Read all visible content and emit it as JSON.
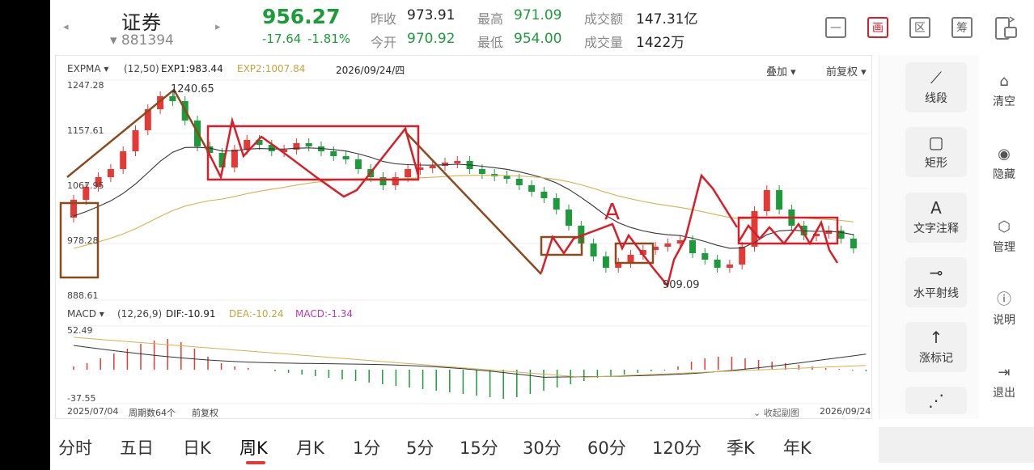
{
  "header": {
    "prev_arrow": "◂",
    "next_arrow": "▸",
    "title": "证券",
    "code": "▾ 881394",
    "price": "956.27",
    "change": "-17.64",
    "change_pct": "-1.81%",
    "stats": {
      "prev_close_label": "昨收",
      "prev_close": "973.91",
      "open_label": "今开",
      "open": "970.92",
      "high_label": "最高",
      "high": "971.09",
      "low_label": "最低",
      "low": "954.00",
      "turnover_label": "成交额",
      "turnover": "147.31亿",
      "volume_label": "成交量",
      "volume": "1422万"
    },
    "top_buttons": [
      "—",
      "画",
      "区",
      "筹"
    ]
  },
  "main_chart": {
    "indicator": "EXPMA",
    "params": "(12,50)",
    "exp1": "EXP1:983.44",
    "exp2": "EXP2:1007.84",
    "date": "2026/09/24/四",
    "overlay_label": "叠加",
    "adjust_label": "前复权",
    "y_ticks": [
      "1247.28",
      "1157.61",
      "1067.95",
      "978.28",
      "888.61"
    ],
    "high_annotation": "1240.65",
    "low_annotation": "909.09",
    "pattern_label": "A"
  },
  "macd_chart": {
    "indicator": "MACD",
    "params": "(12,26,9)",
    "dif": "DIF:-10.91",
    "dea": "DEA:-10.24",
    "macd": "MACD:-1.34",
    "y_top": "52.49",
    "y_bottom": "-37.55"
  },
  "footer_bar": {
    "start_date": "2025/07/04",
    "periods": "周期数64个",
    "adjust": "前复权",
    "collapse": "收起副图",
    "end_date": "2026/09/24"
  },
  "tools": [
    {
      "label": "线段",
      "icon": "line-segment-icon"
    },
    {
      "label": "矩形",
      "icon": "rectangle-icon"
    },
    {
      "label": "文字注释",
      "icon": "text-annotation-icon"
    },
    {
      "label": "水平射线",
      "icon": "horizontal-ray-icon"
    },
    {
      "label": "涨标记",
      "icon": "rise-mark-icon"
    }
  ],
  "side_tools": [
    {
      "label": "清空",
      "icon": "clear-icon"
    },
    {
      "label": "隐藏",
      "icon": "eye-icon"
    },
    {
      "label": "管理",
      "icon": "settings-icon"
    },
    {
      "label": "说明",
      "icon": "help-icon"
    },
    {
      "label": "退出",
      "icon": "exit-icon"
    }
  ],
  "tabs": [
    "分时",
    "五日",
    "日K",
    "周K",
    "月K",
    "1分",
    "5分",
    "15分",
    "30分",
    "60分",
    "120分",
    "季K",
    "年K"
  ],
  "active_tab": "周K",
  "colors": {
    "up": "#e53935",
    "down": "#1c9b3a",
    "exp1": "#333333",
    "exp2": "#d4b24c",
    "box": "#d81e28",
    "brown": "#8b4a1c"
  }
}
